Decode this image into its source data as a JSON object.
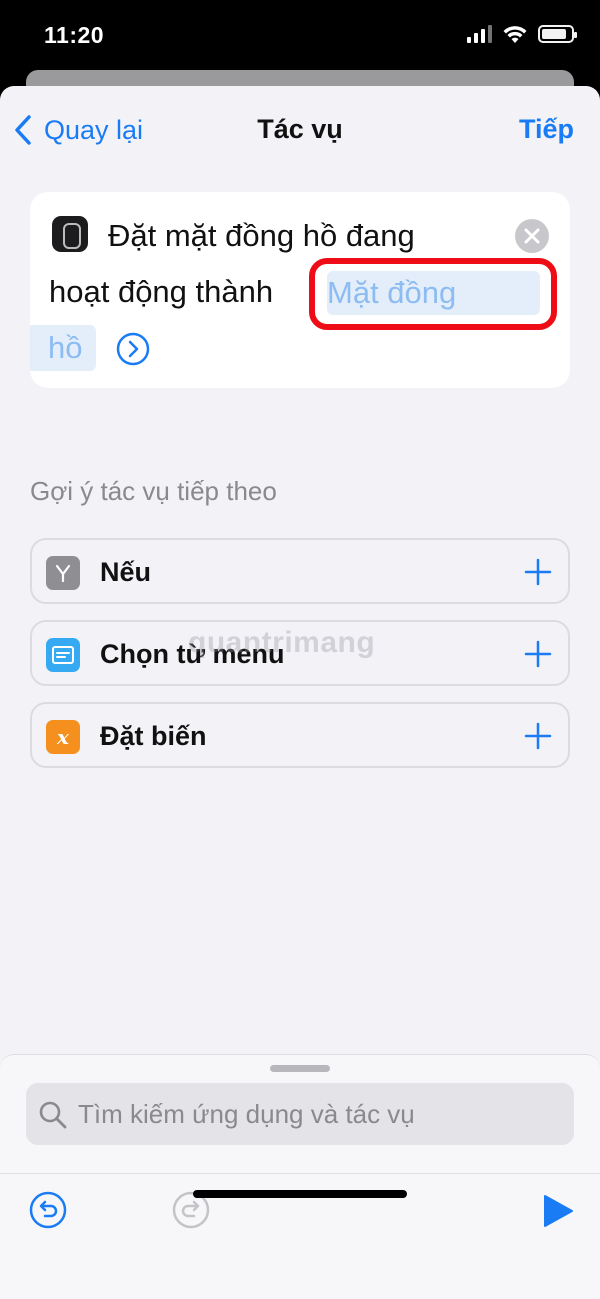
{
  "status_bar": {
    "time": "11:20"
  },
  "nav": {
    "back_label": "Quay lại",
    "title": "Tác vụ",
    "next_label": "Tiếp"
  },
  "action": {
    "line1": "Đặt mặt đồng hồ đang",
    "line2": "hoạt động thành",
    "param_part1": "Mặt đồng",
    "param_part2": "hồ"
  },
  "suggestions": {
    "header": "Gợi ý tác vụ tiếp theo",
    "items": [
      {
        "label": "Nếu",
        "icon": "branch-icon",
        "color": "#8e8e93"
      },
      {
        "label": "Chọn từ menu",
        "icon": "menu-icon",
        "color": "#35aaf2"
      },
      {
        "label": "Đặt biến",
        "icon": "variable-icon",
        "color": "#f5901e"
      }
    ]
  },
  "watermark": "quantrimang",
  "search": {
    "placeholder": "Tìm kiếm ứng dụng và tác vụ"
  },
  "colors": {
    "accent": "#1a7cf5",
    "highlight": "#ee0d16",
    "token_bg": "#e4eefb",
    "token_text": "#8cbcf2"
  }
}
